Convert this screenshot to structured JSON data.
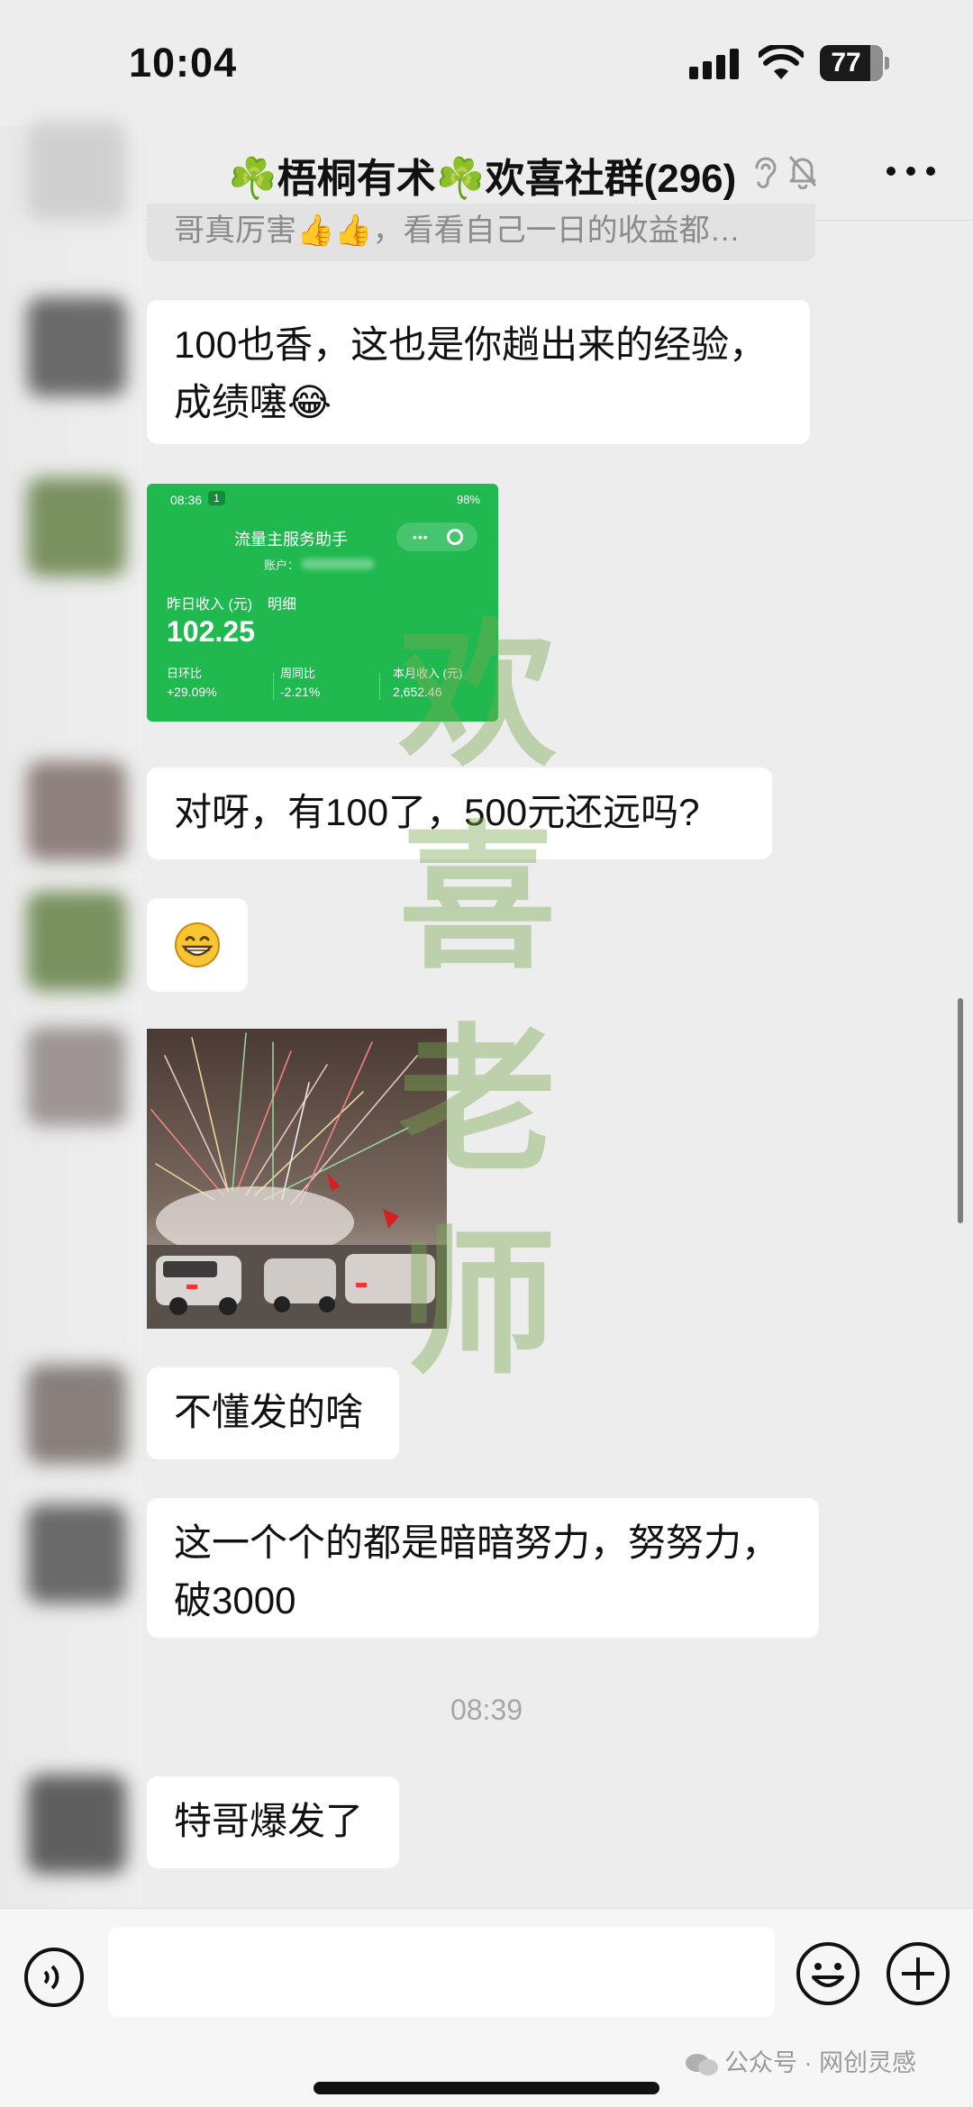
{
  "status_bar": {
    "time": "10:04",
    "battery": "77"
  },
  "nav": {
    "title_prefix": "☘️",
    "title": "梧桐有术",
    "title_middle": "☘️",
    "title_suffix": "欢喜社群(296)"
  },
  "messages": {
    "cut_off": "哥真厉害👍👍，看看自己一日的收益都…",
    "msg1": "100也香，这也是你趟出来的经验，成绩噻😂",
    "mini_card": {
      "time": "08:36",
      "tag": "1",
      "battery": "98%",
      "title": "流量主服务助手",
      "account_label": "账户：",
      "income_label": "昨日收入 (元)",
      "detail_label": "明细",
      "income_value": "102.25",
      "stats": [
        {
          "label": "日环比",
          "value": "+29.09%"
        },
        {
          "label": "周同比",
          "value": "-2.21%"
        },
        {
          "label": "本月收入 (元)",
          "value": "2,652.46"
        }
      ]
    },
    "msg2": "对呀，有100了，500元还远吗?",
    "msg3": "不懂发的啥",
    "msg4": "这一个个的都是暗暗努力，努努力，破3000",
    "divider_time": "08:39",
    "msg5": "特哥爆发了"
  },
  "watermark": [
    "欢",
    "喜",
    "老",
    "师"
  ],
  "footer": {
    "text": "公众号 · 网创灵感"
  },
  "colors": {
    "mini_card_bg": "#1fb94f",
    "chat_bg": "#ededed",
    "clover": "#2e9e3e"
  }
}
